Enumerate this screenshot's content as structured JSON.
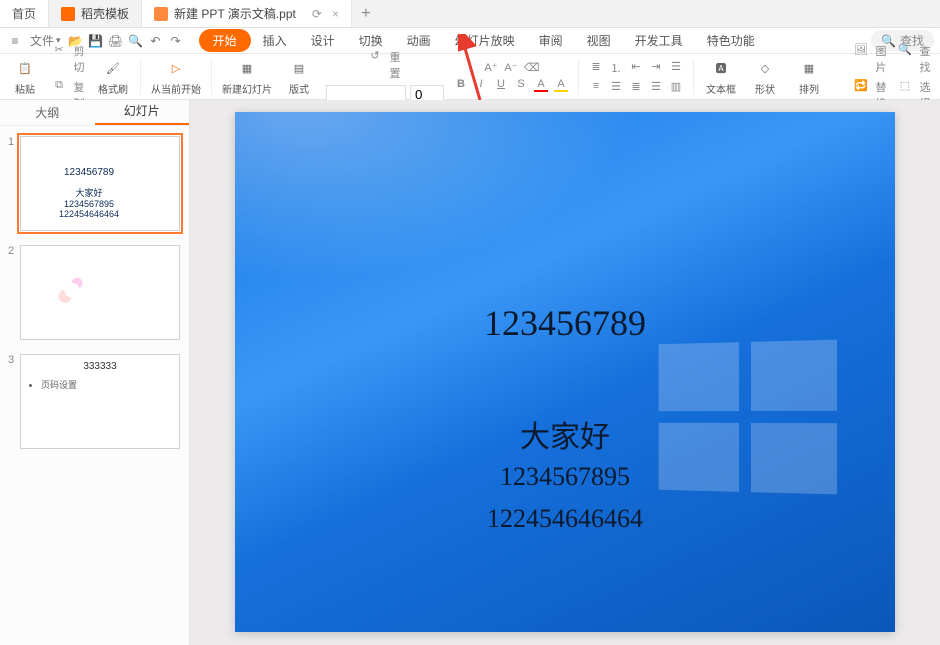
{
  "tabs": {
    "home": "首页",
    "docker": "稻壳模板",
    "doc": "新建 PPT 演示文稿.ppt",
    "refresh": "⟳",
    "close": "×",
    "add": "+"
  },
  "menubar": {
    "file": "文件",
    "qa_icons": [
      "folder-open-icon",
      "save-icon",
      "print-icon",
      "print-preview-icon",
      "undo-icon",
      "redo-icon"
    ],
    "tabs": {
      "start": "开始",
      "insert": "插入",
      "design": "设计",
      "transition": "切换",
      "animation": "动画",
      "slideshow": "幻灯片放映",
      "review": "审阅",
      "view": "视图",
      "dev": "开发工具",
      "special": "特色功能"
    },
    "search_icon": "🔍",
    "search": "查找"
  },
  "ribbon": {
    "paste": "粘贴",
    "cut": "剪切",
    "copy": "复制",
    "format_painter": "格式刷",
    "from_current": "从当前开始",
    "new_slide": "新建幻灯片",
    "layout": "版式",
    "reset": "重置",
    "font_name": "",
    "font_size": "0",
    "textbox": "文本框",
    "shape": "形状",
    "arrange": "排列",
    "picture": "图片",
    "replace": "替换",
    "find": "查找",
    "select": "选择"
  },
  "sidepanel": {
    "outline": "大纲",
    "slides": "幻灯片",
    "s1": {
      "l1": "123456789",
      "l2": "大家好",
      "l3": "1234567895",
      "l4": "122454646464"
    },
    "s3": {
      "title": "333333",
      "bullet": "页码设置"
    }
  },
  "slide": {
    "line1": "123456789",
    "line2": "大家好",
    "line3": "1234567895",
    "line4": "122454646464"
  }
}
